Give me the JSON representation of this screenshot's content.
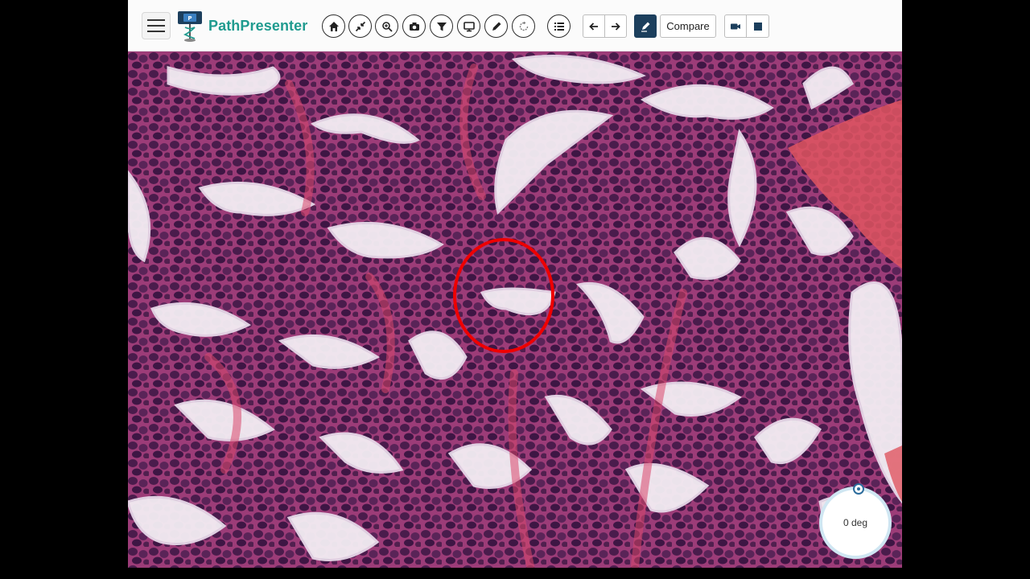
{
  "app": {
    "brand": "PathPresenter"
  },
  "toolbar": {
    "compare_label": "Compare",
    "icons": [
      "menu-icon",
      "home-icon",
      "collapse-icon",
      "zoom-icon",
      "camera-icon",
      "filter-icon",
      "monitor-icon",
      "pencil-icon",
      "rotate-icon",
      "list-icon",
      "arrow-left-icon",
      "arrow-right-icon",
      "annotate-icon",
      "video-icon",
      "stop-icon"
    ]
  },
  "viewer": {
    "rotation_label": "0 deg",
    "annotation": {
      "shape": "ellipse",
      "color": "#e00000"
    },
    "stain_colors": {
      "background": "#b9557f",
      "nuclei": "#4a1c4c",
      "lumen": "#f4eef4",
      "stroma": "#d9476b"
    }
  }
}
